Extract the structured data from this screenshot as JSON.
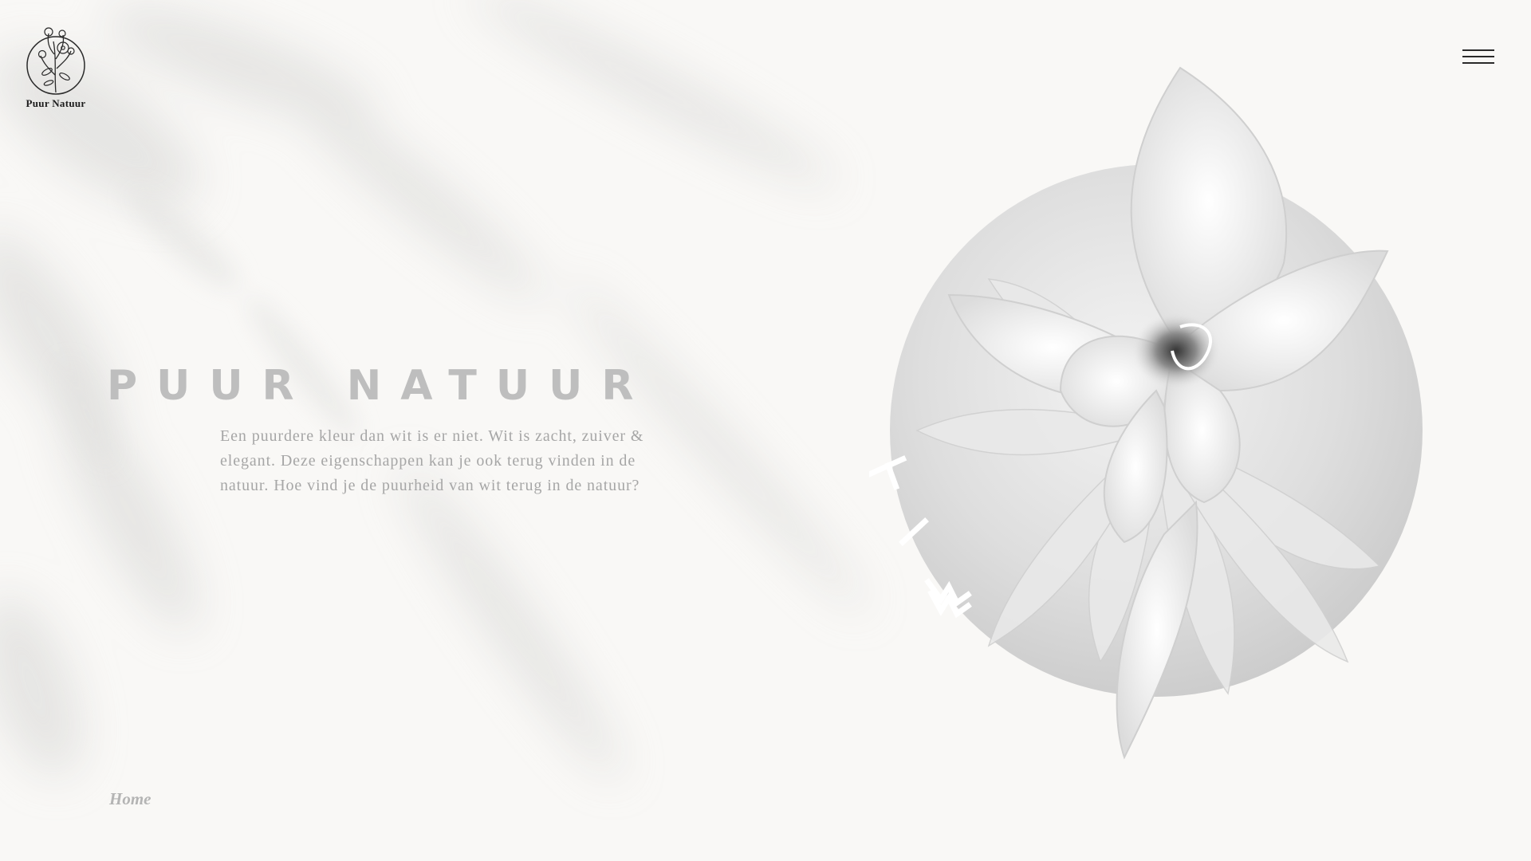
{
  "brand": {
    "name": "Puur Natuur"
  },
  "nav": {
    "menu_icon": "hamburger-menu-icon"
  },
  "hero": {
    "title": "PUUR NATUUR",
    "text": "Een puurdere kleur dan wit is er niet. Wit is zacht, zuiver & elegant. Deze eigenschappen kan je ook terug vinden in de natuur. Hoe vind je de puurheid van wit terug in de natuur?"
  },
  "illustration": {
    "subject": "white-flower-photo",
    "wordmark_icon": "wit-wordmark-icon"
  },
  "breadcrumb": {
    "current": "Home"
  },
  "colors": {
    "background": "#f9f8f6",
    "title": "#bebebe",
    "body_text": "#a6a6a6",
    "accent_dark": "#2a2a2a"
  }
}
